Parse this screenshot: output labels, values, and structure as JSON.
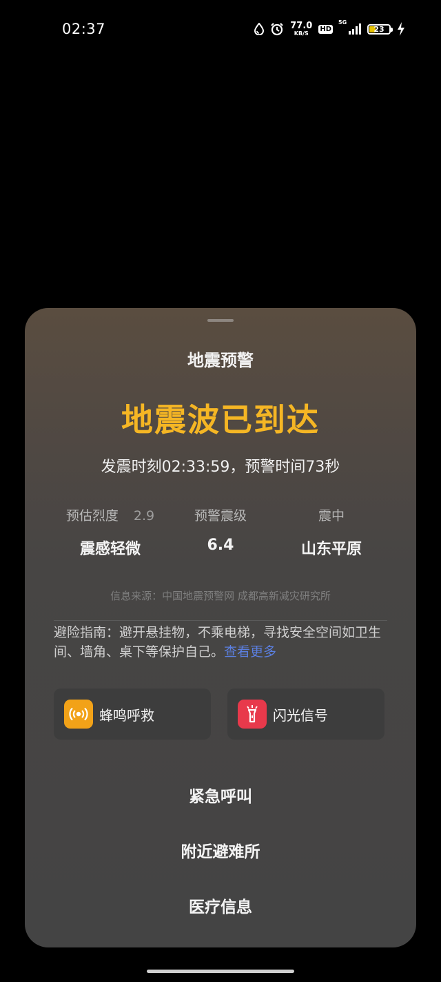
{
  "status_bar": {
    "time": "02:37",
    "speed_value": "77.0",
    "speed_unit": "KB/S",
    "hd_label": "HD",
    "network_label": "5G",
    "battery_level": "23",
    "icons": [
      "water-drop-icon",
      "alarm-icon",
      "hd-icon",
      "signal-icon",
      "battery-icon",
      "charging-icon"
    ]
  },
  "sheet": {
    "title": "地震预警",
    "headline": "地震波已到达",
    "headline_color": "#f5b624",
    "time_info": "发震时刻02:33:59，预警时间73秒",
    "stats": [
      {
        "label": "预估烈度",
        "sub": "2.9",
        "value": "震感轻微"
      },
      {
        "label": "预警震级",
        "value": "6.4"
      },
      {
        "label": "震中",
        "value": "山东平原"
      }
    ],
    "source": "信息来源：中国地震预警网 成都高新减灾研究所",
    "guide_text": "避险指南：避开悬挂物，不乘电梯，寻找安全空间如卫生间、墙角、桌下等保护自己。",
    "guide_link": "查看更多",
    "link_color": "#5b7fe0",
    "cards": [
      {
        "label": "蜂鸣呼救",
        "icon": "siren-icon",
        "color": "#f2a218"
      },
      {
        "label": "闪光信号",
        "icon": "flashlight-icon",
        "color": "#e8394b"
      }
    ],
    "actions": [
      "紧急呼叫",
      "附近避难所",
      "医疗信息"
    ]
  }
}
